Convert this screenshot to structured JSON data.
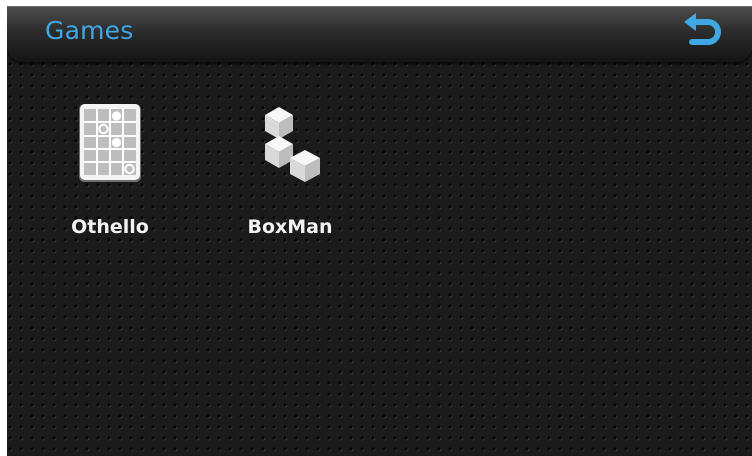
{
  "header": {
    "title": "Games",
    "back_icon": "undo-arrow-icon"
  },
  "apps": [
    {
      "label": "Othello",
      "icon": "othello-board-icon"
    },
    {
      "label": "BoxMan",
      "icon": "stacked-boxes-icon"
    }
  ],
  "colors": {
    "title": "#3fa7e4",
    "back_icon": "#3fa7e4",
    "label": "#f2f2f2",
    "background": "#1b1b1b"
  }
}
